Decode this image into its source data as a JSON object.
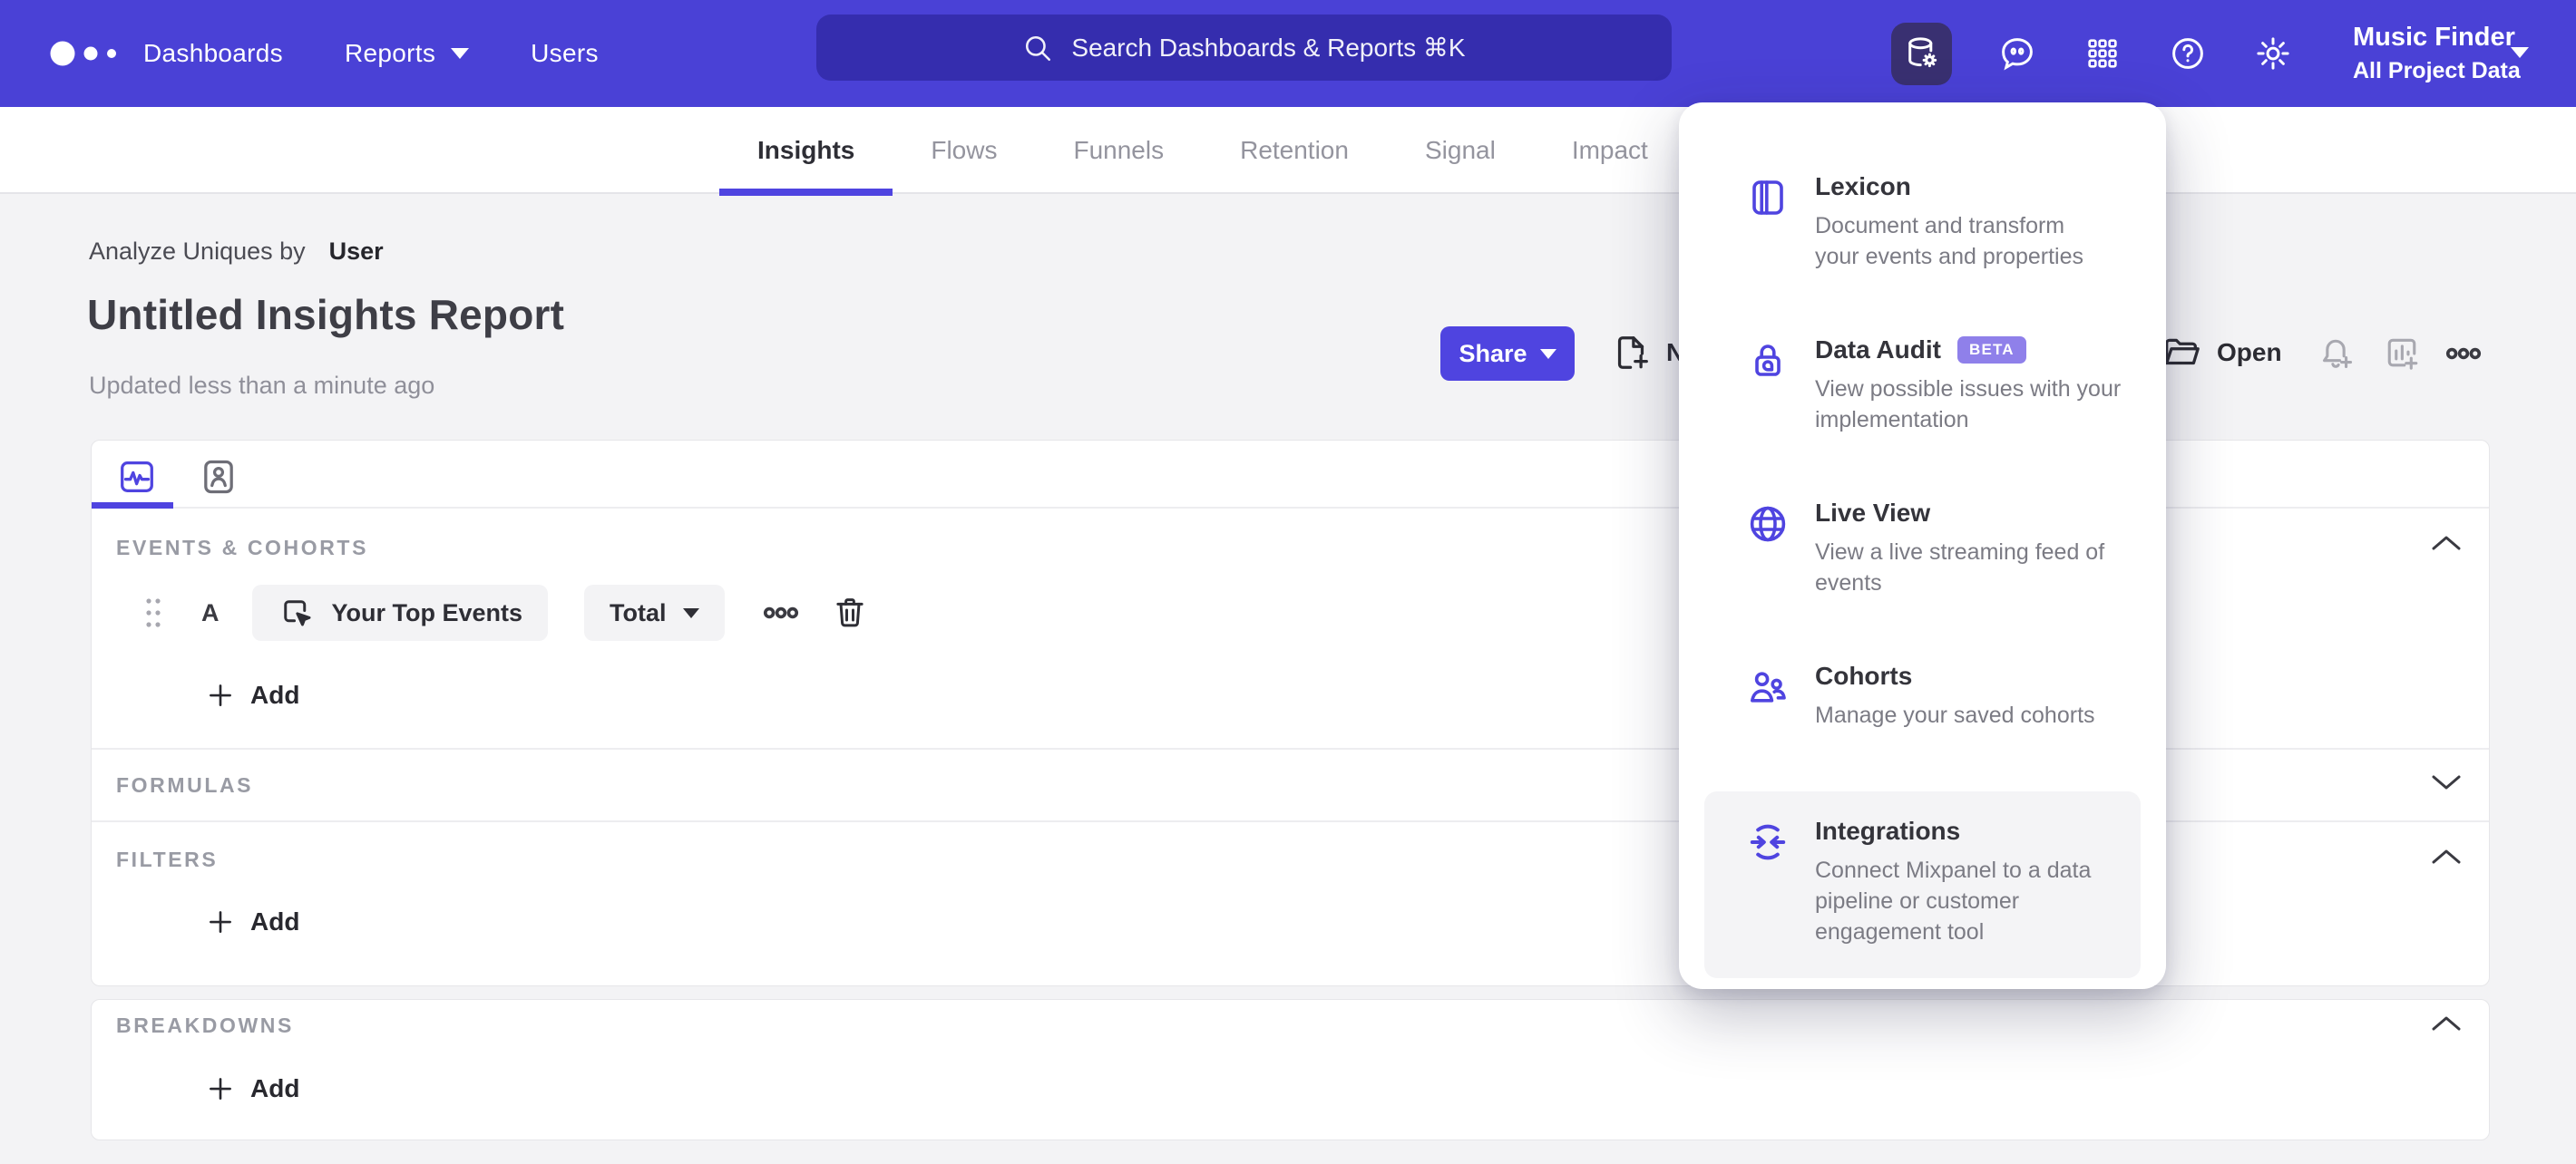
{
  "colors": {
    "brand_indigo": "#4f44e0",
    "nav_background": "#4a41d6",
    "nav_active_icon_background": "#393071",
    "page_background": "#f3f3f5",
    "beta_badge": "#8f80ea",
    "muted_label": "#999ba4"
  },
  "nav": {
    "links": [
      "Dashboards",
      "Reports",
      "Users"
    ],
    "search_placeholder": "Search Dashboards & Reports ⌘K",
    "project": {
      "name": "Music Finder",
      "scope": "All Project Data"
    }
  },
  "tabs": {
    "items": [
      {
        "label": "Insights",
        "active": true
      },
      {
        "label": "Flows",
        "active": false
      },
      {
        "label": "Funnels",
        "active": false
      },
      {
        "label": "Retention",
        "active": false
      },
      {
        "label": "Signal",
        "active": false
      },
      {
        "label": "Impact",
        "active": false
      }
    ]
  },
  "report": {
    "analyze_prefix": "Analyze Uniques by",
    "analyze_value": "User",
    "title": "Untitled Insights Report",
    "updated": "Updated less than a minute ago",
    "share_label": "Share",
    "new_label": "New",
    "open_label": "Open"
  },
  "builder": {
    "events_header": "EVENTS & COHORTS",
    "row": {
      "letter": "A",
      "event": "Your Top Events",
      "metric": "Total"
    },
    "add_label": "Add",
    "formulas_header": "FORMULAS",
    "filters_header": "FILTERS",
    "breakdowns_header": "BREAKDOWNS"
  },
  "menu": {
    "items": [
      {
        "title": "Lexicon",
        "desc": "Document and transform\nyour events and properties"
      },
      {
        "title": "Data Audit",
        "badge": "BETA",
        "desc": "View possible issues with your\nimplementation"
      },
      {
        "title": "Live View",
        "desc": "View a live streaming feed of\nevents"
      },
      {
        "title": "Cohorts",
        "desc": "Manage your saved cohorts"
      },
      {
        "title": "Integrations",
        "desc": "Connect Mixpanel to a data\npipeline or customer\nengagement tool",
        "highlighted": true
      }
    ]
  }
}
